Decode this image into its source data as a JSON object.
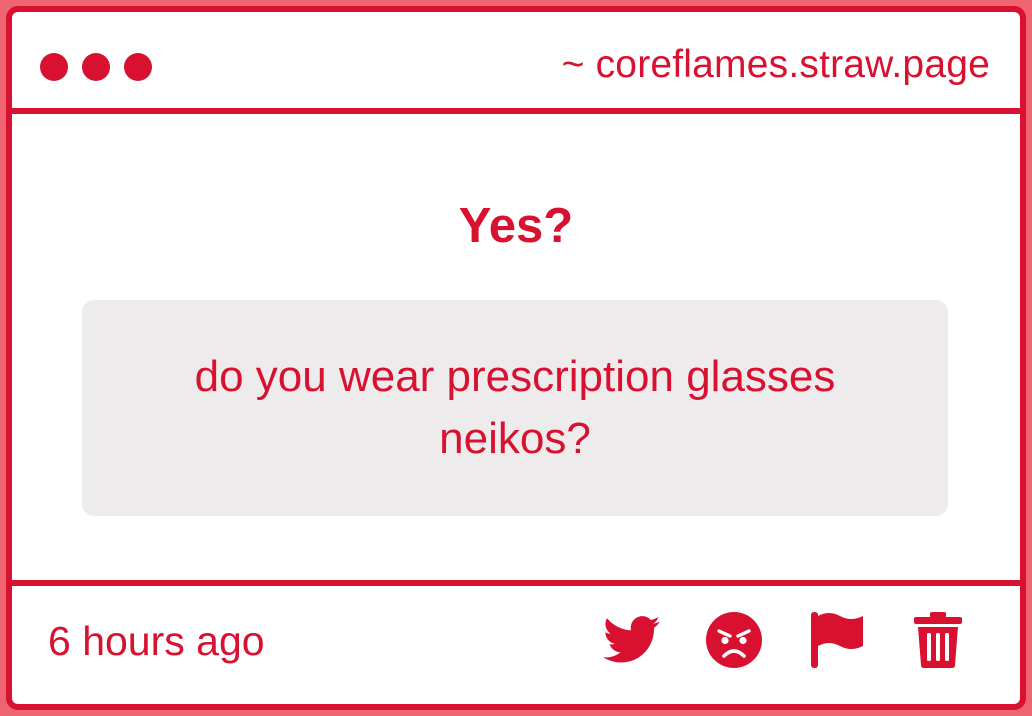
{
  "header": {
    "url": "~ coreflames.straw.page"
  },
  "post": {
    "answer": "Yes?",
    "question": "do you wear prescription glasses neikos?"
  },
  "footer": {
    "timestamp": "6 hours ago",
    "actions": [
      {
        "icon": "twitter-icon"
      },
      {
        "icon": "angry-face-icon"
      },
      {
        "icon": "flag-icon"
      },
      {
        "icon": "trash-icon"
      }
    ]
  },
  "colors": {
    "accent": "#d81130",
    "page_background": "#ef6471",
    "card_background": "#ffffff",
    "question_background": "#eeebec"
  }
}
